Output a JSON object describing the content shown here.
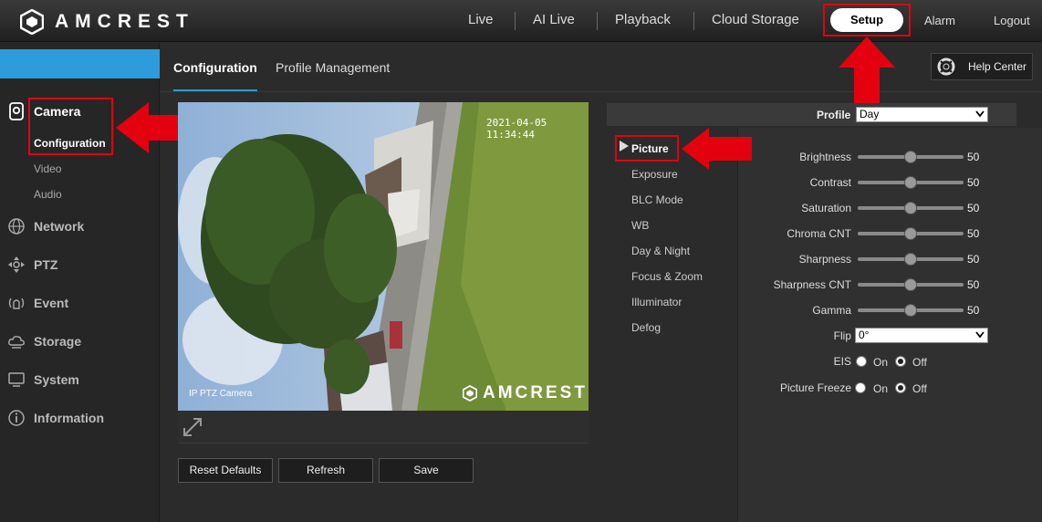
{
  "header": {
    "brand": "AMCREST",
    "nav": {
      "live": "Live",
      "ai_live": "AI Live",
      "playback": "Playback",
      "cloud_storage": "Cloud Storage",
      "setup": "Setup",
      "alarm": "Alarm",
      "logout": "Logout"
    }
  },
  "sidebar": {
    "camera": "Camera",
    "configuration": "Configuration",
    "video": "Video",
    "audio": "Audio",
    "network": "Network",
    "ptz": "PTZ",
    "event": "Event",
    "storage": "Storage",
    "system": "System",
    "information": "Information"
  },
  "tabs": {
    "configuration": "Configuration",
    "profile_management": "Profile Management"
  },
  "help_center": "Help Center",
  "video": {
    "timestamp": "2021-04-05 11:34:44",
    "camera_name": "IP PTZ Camera",
    "brand": "AMCREST"
  },
  "buttons": {
    "reset": "Reset Defaults",
    "refresh": "Refresh",
    "save": "Save"
  },
  "profile": {
    "label": "Profile",
    "value": "Day"
  },
  "menu": {
    "picture": "Picture",
    "exposure": "Exposure",
    "blc_mode": "BLC Mode",
    "wb": "WB",
    "day_night": "Day & Night",
    "focus_zoom": "Focus & Zoom",
    "illuminator": "Illuminator",
    "defog": "Defog"
  },
  "picture": {
    "sliders": [
      {
        "label": "Brightness",
        "value": "50"
      },
      {
        "label": "Contrast",
        "value": "50"
      },
      {
        "label": "Saturation",
        "value": "50"
      },
      {
        "label": "Chroma CNT",
        "value": "50"
      },
      {
        "label": "Sharpness",
        "value": "50"
      },
      {
        "label": "Sharpness CNT",
        "value": "50"
      },
      {
        "label": "Gamma",
        "value": "50"
      }
    ],
    "slider_fraction": 0.5,
    "flip": {
      "label": "Flip",
      "value": "0°"
    },
    "eis": {
      "label": "EIS",
      "on": "On",
      "off": "Off",
      "selected": "Off"
    },
    "picture_freeze": {
      "label": "Picture Freeze",
      "on": "On",
      "off": "Off",
      "selected": "Off"
    }
  },
  "colors": {
    "accent": "#2d9cdb",
    "highlight": "#e3000f"
  }
}
